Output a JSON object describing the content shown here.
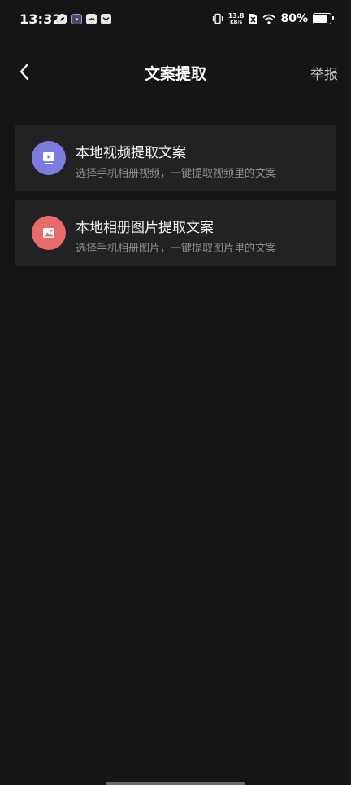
{
  "status_bar": {
    "time": "13:32",
    "net_speed_value": "13.8",
    "net_speed_unit": "KB/s",
    "battery_percent": "80%",
    "battery_level": 0.8,
    "notification_icons": [
      "swirl-icon",
      "play-icon",
      "message-icon",
      "heart-icon"
    ]
  },
  "nav": {
    "title": "文案提取",
    "report_label": "举报",
    "back_icon": "chevron-left-icon"
  },
  "options": [
    {
      "title": "本地视频提取文案",
      "subtitle": "选择手机相册视频，一键提取视频里的文案",
      "icon": "video-icon",
      "icon_color": "#7b7cdc"
    },
    {
      "title": "本地相册图片提取文案",
      "subtitle": "选择手机相册图片，一键提取图片里的文案",
      "icon": "image-icon",
      "icon_color": "#e86a6a"
    }
  ],
  "colors": {
    "background": "#151515",
    "card": "#222224",
    "subtitle": "#8e8e90"
  }
}
